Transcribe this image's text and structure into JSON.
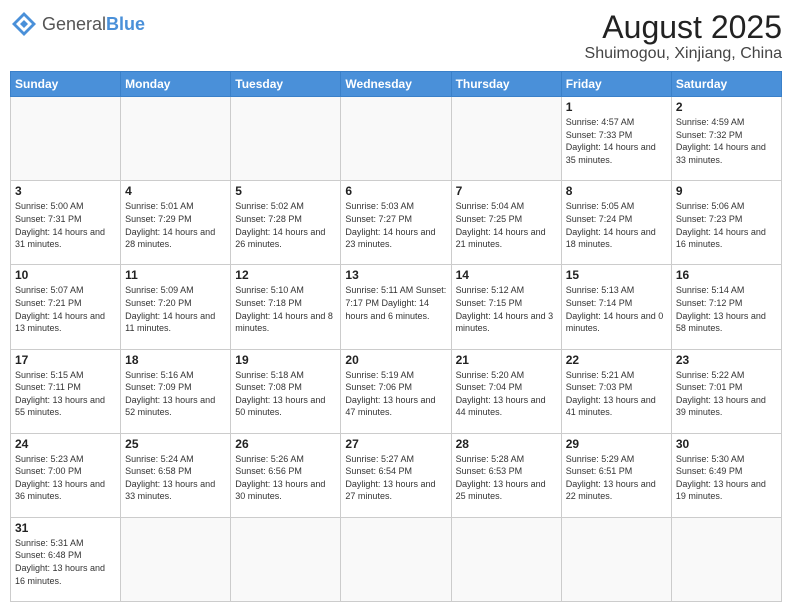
{
  "header": {
    "logo_general": "General",
    "logo_blue": "Blue",
    "title": "August 2025",
    "subtitle": "Shuimogou, Xinjiang, China"
  },
  "days_of_week": [
    "Sunday",
    "Monday",
    "Tuesday",
    "Wednesday",
    "Thursday",
    "Friday",
    "Saturday"
  ],
  "weeks": [
    [
      {
        "day": "",
        "info": ""
      },
      {
        "day": "",
        "info": ""
      },
      {
        "day": "",
        "info": ""
      },
      {
        "day": "",
        "info": ""
      },
      {
        "day": "",
        "info": ""
      },
      {
        "day": "1",
        "info": "Sunrise: 4:57 AM\nSunset: 7:33 PM\nDaylight: 14 hours and 35 minutes."
      },
      {
        "day": "2",
        "info": "Sunrise: 4:59 AM\nSunset: 7:32 PM\nDaylight: 14 hours and 33 minutes."
      }
    ],
    [
      {
        "day": "3",
        "info": "Sunrise: 5:00 AM\nSunset: 7:31 PM\nDaylight: 14 hours and 31 minutes."
      },
      {
        "day": "4",
        "info": "Sunrise: 5:01 AM\nSunset: 7:29 PM\nDaylight: 14 hours and 28 minutes."
      },
      {
        "day": "5",
        "info": "Sunrise: 5:02 AM\nSunset: 7:28 PM\nDaylight: 14 hours and 26 minutes."
      },
      {
        "day": "6",
        "info": "Sunrise: 5:03 AM\nSunset: 7:27 PM\nDaylight: 14 hours and 23 minutes."
      },
      {
        "day": "7",
        "info": "Sunrise: 5:04 AM\nSunset: 7:25 PM\nDaylight: 14 hours and 21 minutes."
      },
      {
        "day": "8",
        "info": "Sunrise: 5:05 AM\nSunset: 7:24 PM\nDaylight: 14 hours and 18 minutes."
      },
      {
        "day": "9",
        "info": "Sunrise: 5:06 AM\nSunset: 7:23 PM\nDaylight: 14 hours and 16 minutes."
      }
    ],
    [
      {
        "day": "10",
        "info": "Sunrise: 5:07 AM\nSunset: 7:21 PM\nDaylight: 14 hours and 13 minutes."
      },
      {
        "day": "11",
        "info": "Sunrise: 5:09 AM\nSunset: 7:20 PM\nDaylight: 14 hours and 11 minutes."
      },
      {
        "day": "12",
        "info": "Sunrise: 5:10 AM\nSunset: 7:18 PM\nDaylight: 14 hours and 8 minutes."
      },
      {
        "day": "13",
        "info": "Sunrise: 5:11 AM\nSunset: 7:17 PM\nDaylight: 14 hours and 6 minutes."
      },
      {
        "day": "14",
        "info": "Sunrise: 5:12 AM\nSunset: 7:15 PM\nDaylight: 14 hours and 3 minutes."
      },
      {
        "day": "15",
        "info": "Sunrise: 5:13 AM\nSunset: 7:14 PM\nDaylight: 14 hours and 0 minutes."
      },
      {
        "day": "16",
        "info": "Sunrise: 5:14 AM\nSunset: 7:12 PM\nDaylight: 13 hours and 58 minutes."
      }
    ],
    [
      {
        "day": "17",
        "info": "Sunrise: 5:15 AM\nSunset: 7:11 PM\nDaylight: 13 hours and 55 minutes."
      },
      {
        "day": "18",
        "info": "Sunrise: 5:16 AM\nSunset: 7:09 PM\nDaylight: 13 hours and 52 minutes."
      },
      {
        "day": "19",
        "info": "Sunrise: 5:18 AM\nSunset: 7:08 PM\nDaylight: 13 hours and 50 minutes."
      },
      {
        "day": "20",
        "info": "Sunrise: 5:19 AM\nSunset: 7:06 PM\nDaylight: 13 hours and 47 minutes."
      },
      {
        "day": "21",
        "info": "Sunrise: 5:20 AM\nSunset: 7:04 PM\nDaylight: 13 hours and 44 minutes."
      },
      {
        "day": "22",
        "info": "Sunrise: 5:21 AM\nSunset: 7:03 PM\nDaylight: 13 hours and 41 minutes."
      },
      {
        "day": "23",
        "info": "Sunrise: 5:22 AM\nSunset: 7:01 PM\nDaylight: 13 hours and 39 minutes."
      }
    ],
    [
      {
        "day": "24",
        "info": "Sunrise: 5:23 AM\nSunset: 7:00 PM\nDaylight: 13 hours and 36 minutes."
      },
      {
        "day": "25",
        "info": "Sunrise: 5:24 AM\nSunset: 6:58 PM\nDaylight: 13 hours and 33 minutes."
      },
      {
        "day": "26",
        "info": "Sunrise: 5:26 AM\nSunset: 6:56 PM\nDaylight: 13 hours and 30 minutes."
      },
      {
        "day": "27",
        "info": "Sunrise: 5:27 AM\nSunset: 6:54 PM\nDaylight: 13 hours and 27 minutes."
      },
      {
        "day": "28",
        "info": "Sunrise: 5:28 AM\nSunset: 6:53 PM\nDaylight: 13 hours and 25 minutes."
      },
      {
        "day": "29",
        "info": "Sunrise: 5:29 AM\nSunset: 6:51 PM\nDaylight: 13 hours and 22 minutes."
      },
      {
        "day": "30",
        "info": "Sunrise: 5:30 AM\nSunset: 6:49 PM\nDaylight: 13 hours and 19 minutes."
      }
    ],
    [
      {
        "day": "31",
        "info": "Sunrise: 5:31 AM\nSunset: 6:48 PM\nDaylight: 13 hours and 16 minutes."
      },
      {
        "day": "",
        "info": ""
      },
      {
        "day": "",
        "info": ""
      },
      {
        "day": "",
        "info": ""
      },
      {
        "day": "",
        "info": ""
      },
      {
        "day": "",
        "info": ""
      },
      {
        "day": "",
        "info": ""
      }
    ]
  ]
}
